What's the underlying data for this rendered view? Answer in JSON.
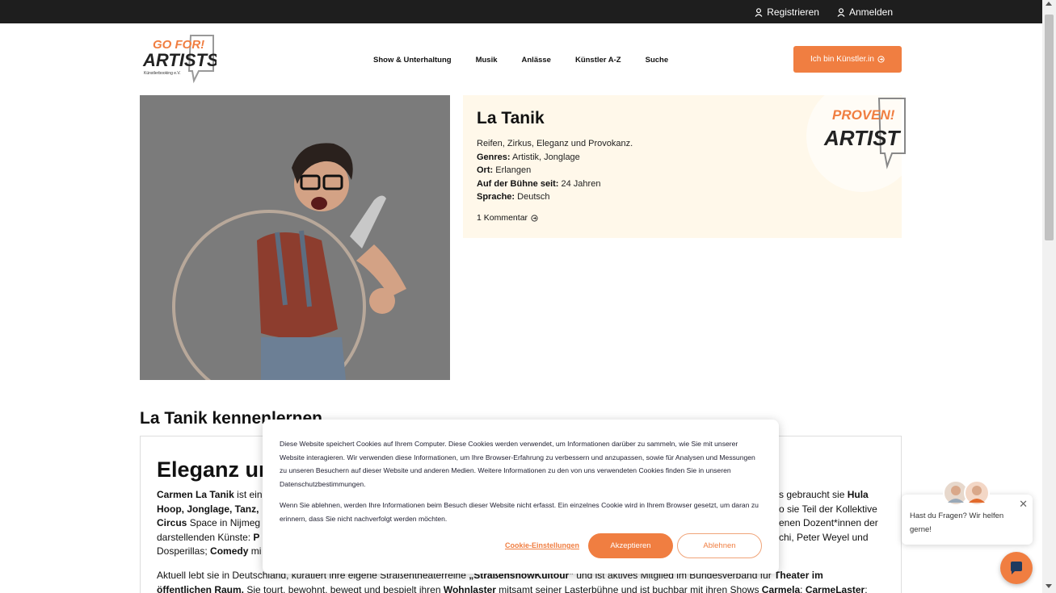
{
  "topbar": {
    "register": "Registrieren",
    "login": "Anmelden"
  },
  "logo": {
    "line1": "GO FOR!",
    "line2": "ARTISTS",
    "line3": "Künstlerbooking e.V."
  },
  "nav": {
    "items": [
      "Show & Unterhaltung",
      "Musik",
      "Anlässe",
      "Künstler A-Z",
      "Suche"
    ],
    "cta": "Ich bin Künstler.in"
  },
  "artist": {
    "name": "La Tanik",
    "tagline": "Reifen, Zirkus, Eleganz und Provokanz.",
    "genres_label": "Genres:",
    "genres": "Artistik, Jonglage",
    "ort_label": "Ort:",
    "ort": "Erlangen",
    "since_label": "Auf der Bühne seit:",
    "since": "24 Jahren",
    "sprache_label": "Sprache:",
    "sprache": "Deutsch",
    "comments": "1 Kommentar"
  },
  "badge": {
    "line1": "PROVEN!",
    "line2": "ARTIST"
  },
  "section": {
    "title": "La Tanik kennenlernen",
    "heading": "Eleganz ur",
    "p1_l1_a": "Carmen La Tanik",
    "p1_l1_b": " ist ein",
    "p1_l2": "Hoop, Jonglage, Tanz,",
    "p1_l3_a": "Circus",
    "p1_l3_b": " Space in Nijmeg",
    "p1_l4_a": "darstellenden Künste: ",
    "p1_l4_b": "P",
    "p1_l5_a": "Dosperillas; ",
    "p1_l5_b": "Comedy",
    "p1_l5_c": " mi",
    "r1_a": "s gebraucht sie ",
    "r1_b": "Hula",
    "r2": "o sie Teil der Kollektive",
    "r3": "enen Dozent*innen der",
    "r4": "chi, Peter Weyel und",
    "p2_l1_a": "Aktuell lebt sie in Deutschland, kuratiert ihre eigene Straßentheaterreihe ",
    "p2_l1_b": "„StraßenshowKultour\"",
    "p2_l1_c": " und ist aktives Mitglied im Bundesverband für ",
    "p2_l1_d": "Theater im",
    "p2_l2_a": "öffentlichen Raum.",
    "p2_l2_b": " Sie tourt, bewohnt, bewegt und bespielt ihren ",
    "p2_l2_c": "Wohnlaster",
    "p2_l2_d": " mitsamt seiner Lasterbühne und ist buchbar mit ihren Shows ",
    "p2_l2_e": "Carmela",
    "p2_l2_f": "; ",
    "p2_l2_g": "CarmeLaster",
    "p2_l2_h": ";"
  },
  "cookie": {
    "text1": "Diese Website speichert Cookies auf Ihrem Computer. Diese Cookies werden verwendet, um Informationen darüber zu sammeln, wie Sie mit unserer Website interagieren. Wir verwenden diese Informationen, um Ihre Browser-Erfahrung zu verbessern und anzupassen, sowie für Analysen und Messungen zu unseren Besuchern auf dieser Website und anderen Medien. Weitere Informationen zu den von uns verwendeten Cookies finden Sie in unseren Datenschutzbestimmungen.",
    "text2": "Wenn Sie ablehnen, werden Ihre Informationen beim Besuch dieser Website nicht erfasst. Ein einzelnes Cookie wird in Ihrem Browser gesetzt, um daran zu erinnern, dass Sie nicht nachverfolgt werden möchten.",
    "settings": "Cookie-Einstellungen",
    "accept": "Akzeptieren",
    "decline": "Ablehnen"
  },
  "chat": {
    "text": "Hast du Fragen? Wir helfen gerne!",
    "close": "✕"
  },
  "colors": {
    "accent": "#f07e41",
    "topbar": "#1e1e1e",
    "card": "#fff8ea"
  }
}
